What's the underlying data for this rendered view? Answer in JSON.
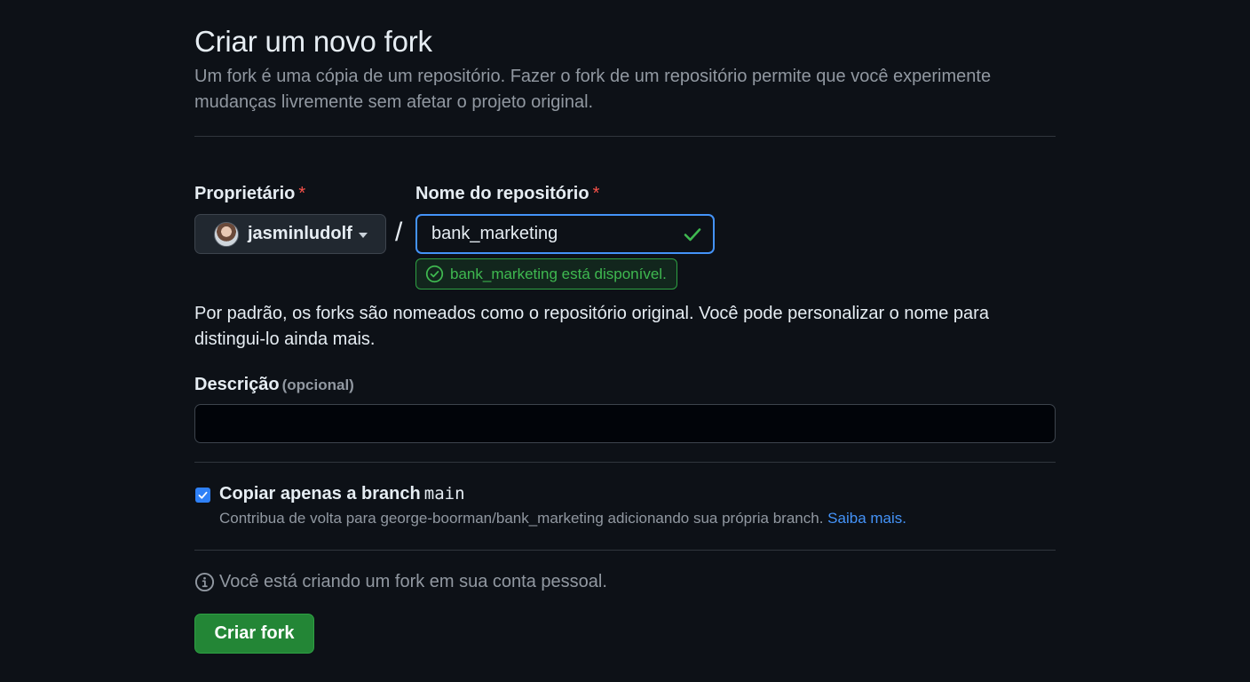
{
  "header": {
    "title": "Criar um novo fork",
    "subtitle": "Um fork é uma cópia de um repositório. Fazer o fork de um repositório permite que você experimente mudanças livremente sem afetar o projeto original."
  },
  "form": {
    "owner_label": "Proprietário",
    "required_mark": "*",
    "owner_value": "jasminludolf",
    "separator": "/",
    "repo_label": "Nome do repositório",
    "repo_value": "bank_marketing",
    "availability": "bank_marketing está disponível.",
    "help_text": "Por padrão, os forks são nomeados como o repositório original. Você pode personalizar o nome para distingui-lo ainda mais.",
    "description_label": "Descrição",
    "description_optional": "(opcional)",
    "description_value": "",
    "copy_branch_label": "Copiar apenas a branch",
    "copy_branch_name": "main",
    "copy_branch_checked": true,
    "copy_branch_help": "Contribua de volta para george-boorman/bank_marketing adicionando sua própria branch.",
    "learn_more": "Saiba mais.",
    "info_text": "Você está criando um fork em sua conta pessoal.",
    "submit_label": "Criar fork"
  },
  "colors": {
    "background": "#0d1117",
    "accent_blue": "#4493f8",
    "success_green": "#3fb950",
    "button_green": "#238636",
    "required_red": "#f85149"
  },
  "icons": {
    "owner_avatar": "avatar",
    "owner_dropdown": "caret-down-icon",
    "repo_valid": "check-icon",
    "availability": "check-circle-icon",
    "info": "info-icon"
  }
}
